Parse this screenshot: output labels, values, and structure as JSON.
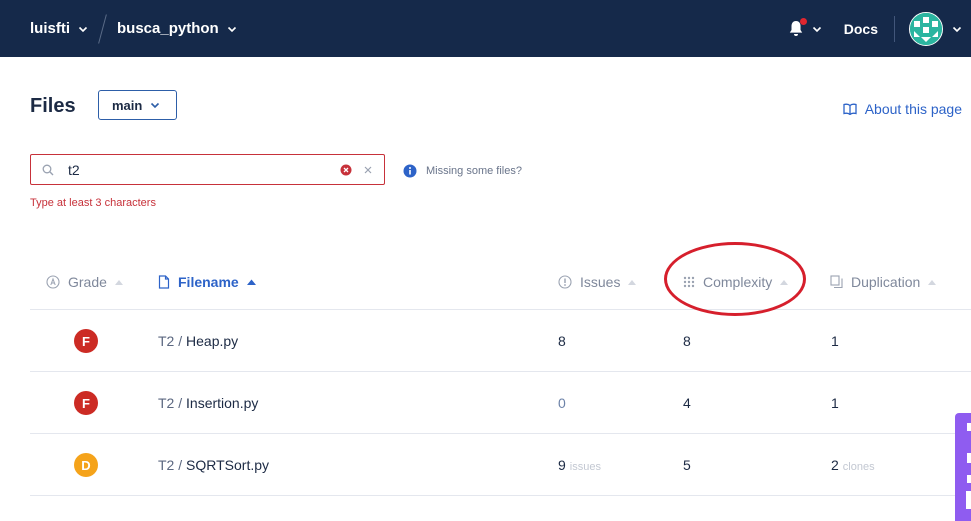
{
  "topbar": {
    "org": "luisfti",
    "project": "busca_python",
    "docs_label": "Docs",
    "colors": {
      "background": "#15294a",
      "notification_dot": "#e0262f"
    }
  },
  "page": {
    "title": "Files",
    "branch": "main",
    "about_label": "About this page"
  },
  "search": {
    "value": "t2",
    "error": "Type at least 3 characters",
    "missing_files_label": "Missing some files?"
  },
  "table": {
    "headers": {
      "grade": "Grade",
      "filename": "Filename",
      "issues": "Issues",
      "complexity": "Complexity",
      "duplication": "Duplication"
    },
    "sorted_by": "filename",
    "rows": [
      {
        "grade": "F",
        "grade_color": "#cc2b24",
        "folder": "T2",
        "sep": "/",
        "file": "Heap.py",
        "issues": "8",
        "issues_suffix": "",
        "complexity": "8",
        "duplication": "1",
        "duplication_suffix": ""
      },
      {
        "grade": "F",
        "grade_color": "#cc2b24",
        "folder": "T2",
        "sep": "/",
        "file": "Insertion.py",
        "issues": "0",
        "issues_suffix": "",
        "complexity": "4",
        "duplication": "1",
        "duplication_suffix": ""
      },
      {
        "grade": "D",
        "grade_color": "#f5a31a",
        "folder": "T2",
        "sep": "/",
        "file": "SQRTSort.py",
        "issues": "9",
        "issues_suffix": "issues",
        "complexity": "5",
        "duplication": "2",
        "duplication_suffix": "clones"
      }
    ]
  },
  "annotation": {
    "highlight": "complexity-header",
    "color": "#d61f2c"
  }
}
